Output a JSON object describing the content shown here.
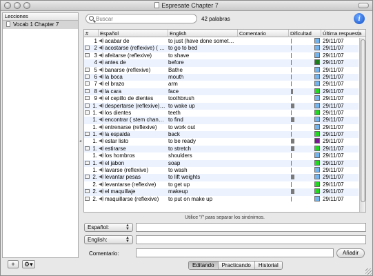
{
  "window": {
    "title": "Espresate Chapter 7"
  },
  "sidebar": {
    "header": "Lecciones",
    "items": [
      {
        "label": "Vocab 1 Chapter 7"
      }
    ],
    "add_label": "+",
    "action_label": "⚙▾"
  },
  "search": {
    "placeholder": "Buscar",
    "value": ""
  },
  "word_count": "42 palabras",
  "table": {
    "columns": [
      "#",
      "Español",
      "English",
      "Comentario",
      "Dificultad",
      "Última respuesta"
    ],
    "rows": [
      {
        "num": "1",
        "es": "acabar de",
        "en": "to just (have done somet…",
        "bar": 0.05,
        "color": "#74b4ee",
        "date": "29/11/07",
        "note": false
      },
      {
        "num": "2",
        "es": "acostarse (reflexive) ( …",
        "en": "to go to bed",
        "bar": 0.05,
        "color": "#74b4ee",
        "date": "29/11/07",
        "note": true
      },
      {
        "num": "3",
        "es": "afeitarse (reflexive)",
        "en": "to shave",
        "bar": 0.05,
        "color": "#74b4ee",
        "date": "29/11/07",
        "note": true
      },
      {
        "num": "4",
        "es": "antes de",
        "en": "before",
        "bar": 0.05,
        "color": "#1a7f1a",
        "date": "29/11/07",
        "note": false
      },
      {
        "num": "5",
        "es": "banarse (reflexive)",
        "en": "Bathe",
        "bar": 0.12,
        "color": "#74b4ee",
        "date": "29/11/07",
        "note": true
      },
      {
        "num": "6",
        "es": "la boca",
        "en": "mouth",
        "bar": 0.05,
        "color": "#74b4ee",
        "date": "29/11/07",
        "note": true
      },
      {
        "num": "7",
        "es": "el brazo",
        "en": "arm",
        "bar": 0.05,
        "color": "#74b4ee",
        "date": "29/11/07",
        "note": true
      },
      {
        "num": "8",
        "es": "la cara",
        "en": "face",
        "bar": 0.35,
        "color": "#22d822",
        "date": "29/11/07",
        "note": true
      },
      {
        "num": "9",
        "es": "el cepillo de dientes",
        "en": "toothbrush",
        "bar": 0.05,
        "color": "#74b4ee",
        "date": "29/11/07",
        "note": true
      },
      {
        "num": "1.",
        "es": "despertarse (reflexive)…",
        "en": "to wake up",
        "bar": 0.6,
        "color": "#74b4ee",
        "date": "29/11/07",
        "note": true
      },
      {
        "num": "1.",
        "es": "los dientes",
        "en": "teeth",
        "bar": 0.05,
        "color": "#22d822",
        "date": "29/11/07",
        "note": true
      },
      {
        "num": "1.",
        "es": "encontrar ( stem chan…",
        "en": "to find",
        "bar": 0.6,
        "color": "#74b4ee",
        "date": "29/11/07",
        "note": false
      },
      {
        "num": "1.",
        "es": "entrenarse (reflexive)",
        "en": "to work out",
        "bar": 0.05,
        "color": "#74b4ee",
        "date": "29/11/07",
        "note": false
      },
      {
        "num": "1.",
        "es": "la espalda",
        "en": "back",
        "bar": 0.05,
        "color": "#22d822",
        "date": "29/11/07",
        "note": true
      },
      {
        "num": "1.",
        "es": "estar listo",
        "en": "to be ready",
        "bar": 0.6,
        "color": "#7a1696",
        "date": "29/11/07",
        "note": false
      },
      {
        "num": "1.",
        "es": "estirarse",
        "en": "to stretch",
        "bar": 0.6,
        "color": "#22d822",
        "date": "29/11/07",
        "note": true
      },
      {
        "num": "1.",
        "es": "los hombros",
        "en": "shoulders",
        "bar": 0.05,
        "color": "#74b4ee",
        "date": "29/11/07",
        "note": false
      },
      {
        "num": "1.",
        "es": "el jabon",
        "en": "soap",
        "bar": 0.05,
        "color": "#22d822",
        "date": "29/11/07",
        "note": true
      },
      {
        "num": "1.",
        "es": "lavarse (reflexive)",
        "en": "to wash",
        "bar": 0.05,
        "color": "#74b4ee",
        "date": "29/11/07",
        "note": false
      },
      {
        "num": "2.",
        "es": "levantar pesas",
        "en": "to lift weights",
        "bar": 0.6,
        "color": "#74b4ee",
        "date": "29/11/07",
        "note": true
      },
      {
        "num": "2.",
        "es": "levantarse (reflexive)",
        "en": "to get up",
        "bar": 0.05,
        "color": "#22d822",
        "date": "29/11/07",
        "note": false
      },
      {
        "num": "2.",
        "es": "el maquillaje",
        "en": "makeup",
        "bar": 0.6,
        "color": "#22d822",
        "date": "29/11/07",
        "note": true
      },
      {
        "num": "2.",
        "es": "maquillarse (reflexive)",
        "en": "to put on make up",
        "bar": 0.05,
        "color": "#74b4ee",
        "date": "29/11/07",
        "note": true
      }
    ]
  },
  "hint": "Utilice \"/\" para separar los sinónimos.",
  "form": {
    "lang1": "Español:",
    "lang2": "English:",
    "comment_label": "Comentario:",
    "add_button": "Añadir"
  },
  "tabs": [
    "Editando",
    "Practicando",
    "Historial"
  ]
}
